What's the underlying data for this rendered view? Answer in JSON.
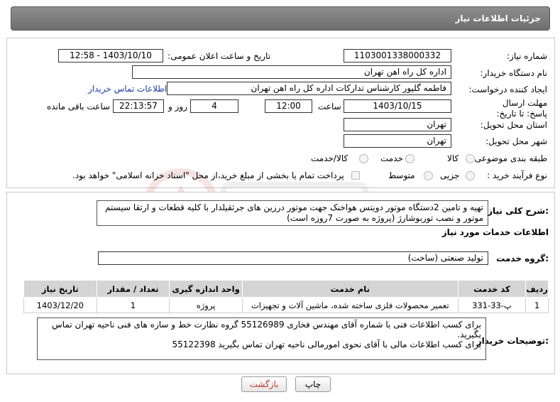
{
  "header": {
    "title": "جزئیات اطلاعات نیاز"
  },
  "fields": {
    "need_number_label": "شماره نیاز:",
    "need_number": "1103001338000332",
    "announce_label": "تاریخ و ساعت اعلان عمومی:",
    "announce_value": "1403/10/10 - 12:58",
    "buyer_label": "نام دستگاه خریدار:",
    "buyer_value": "اداره کل راه اهن تهران",
    "creator_label": "ایجاد کننده درخواست:",
    "creator_value": "فاطمه گلپور کارشناس تدارکات اداره کل راه اهن تهران",
    "contact_link": "اطلاعات تماس خریدار",
    "deadline_label": "مهلت ارسال پاسخ: تا تاریخ:",
    "deadline_date": "1403/10/15",
    "time_label": "ساعت",
    "deadline_time": "12:00",
    "days_value": "4",
    "days_label": "روز و",
    "remaining_time": "22:13:57",
    "remaining_label": "ساعت باقی مانده",
    "province_label": "استان محل تحویل:",
    "province_value": "تهران",
    "city_label": "شهر محل تحویل:",
    "city_value": "تهران",
    "category_label": "طبقه بندی موضوعی:",
    "category_opt_goods": "کالا",
    "category_opt_service": "خدمت",
    "category_opt_both": "کالا/خدمت",
    "process_label": "نوع فرآیند خرید :",
    "process_opt_minor": "جزیی",
    "process_opt_medium": "متوسط",
    "payment_note": "پرداخت تمام یا بخشی از مبلغ خرید،از محل \"اسناد خزانه اسلامی\" خواهد بود."
  },
  "description": {
    "label": "شرح کلی نیاز:",
    "text": "تهیه و تامین 2دستگاه موتور دویتس هواخنک جهت موتور درزین های جرثقیلدار با کلیه قطعات و ارتقا سیستم موتور و نصب توربوشارژ (پروژه به صورت 7روزه است)"
  },
  "services": {
    "section_title": "اطلاعات خدمات مورد نیاز",
    "group_label": "گروه خدمت:",
    "group_value": "تولید صنعتی (ساخت)",
    "columns": [
      "ردیف",
      "کد خدمت",
      "نام خدمت",
      "واحد اندازه گیری",
      "تعداد / مقدار",
      "تاریخ نیاز"
    ],
    "rows": [
      [
        "1",
        "پ-33-331",
        "تعمیر محصولات فلزی ساخته شده، ماشین آلات و تجهیزات",
        "پروژه",
        "1",
        "1403/12/20"
      ]
    ]
  },
  "buyer_notes": {
    "label": "توضیحات خریدار:",
    "line1": "برای کسب اطلاعات فنی با شماره آقای مهندس فخاری 55126989 گروه نظارت خط و سازه های فنی ناحیه تهران تماس بگیرید.",
    "line2": "برای کسب اطلاعات مالی با آقای نحوی امورمالی ناحیه تهران تماس بگیرید 55122398"
  },
  "buttons": {
    "print": "چاپ",
    "back": "بازگشت"
  },
  "colors": {
    "header_bg": "#7a7a7a",
    "link": "#1a3fa8",
    "back_text": "#c0392b"
  }
}
